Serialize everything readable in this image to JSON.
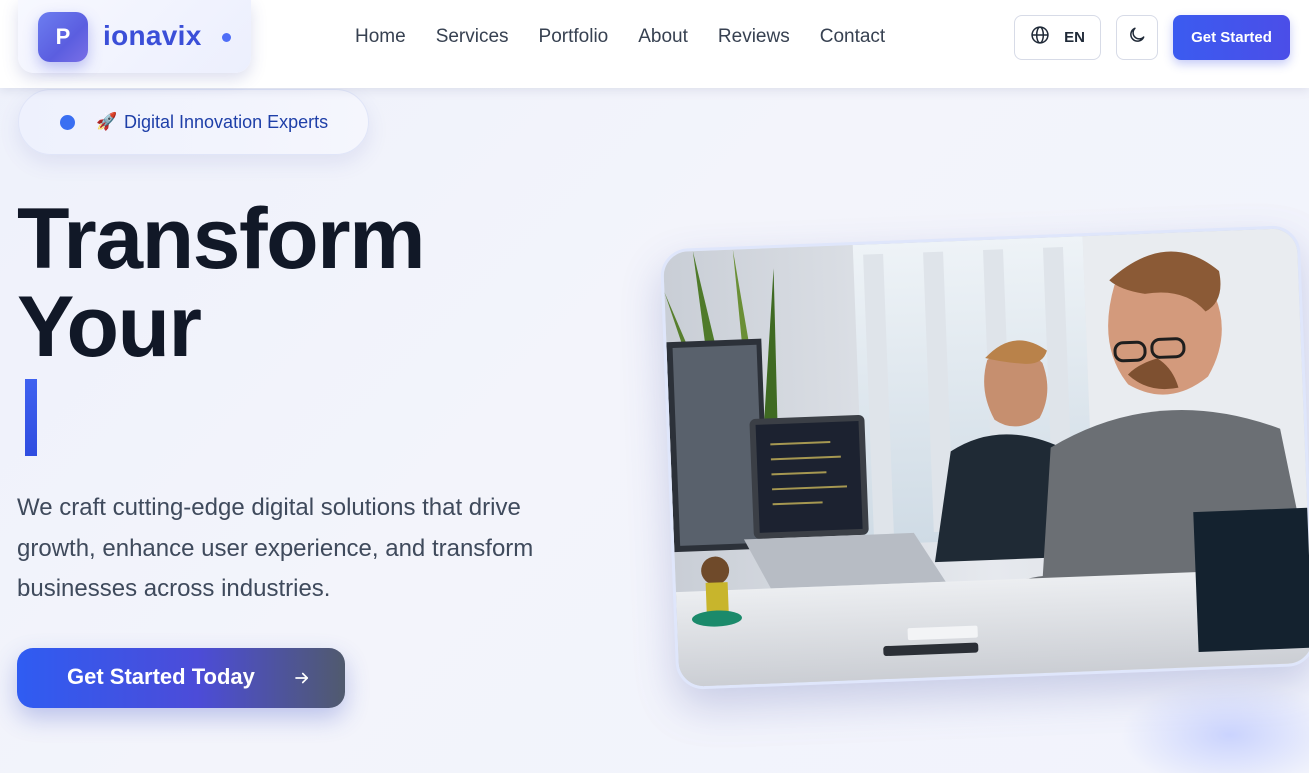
{
  "brand": {
    "logo_letter": "P",
    "name": "ionavix"
  },
  "nav": {
    "items": [
      {
        "label": "Home"
      },
      {
        "label": "Services"
      },
      {
        "label": "Portfolio"
      },
      {
        "label": "About"
      },
      {
        "label": "Reviews"
      },
      {
        "label": "Contact"
      }
    ]
  },
  "header_actions": {
    "language_icon": "globe-icon",
    "language_code": "EN",
    "theme_icon": "moon-icon",
    "cta_label": "Get Started"
  },
  "hero": {
    "badge_icon": "rocket-icon",
    "badge_text": "Digital Innovation Experts",
    "headline_line1": "Transform",
    "headline_line2": "Your",
    "description": "We craft cutting-edge digital solutions that drive growth, enhance user experience, and transform businesses across industries.",
    "cta_label": "Get Started Today",
    "cta_icon": "arrow-right-icon",
    "image_alt": "Two developers working at computers in an office"
  },
  "colors": {
    "accent": "#3b5bf0",
    "brand_text": "#3b4fd8",
    "heading": "#111827",
    "body_text": "#3f4a5c"
  }
}
